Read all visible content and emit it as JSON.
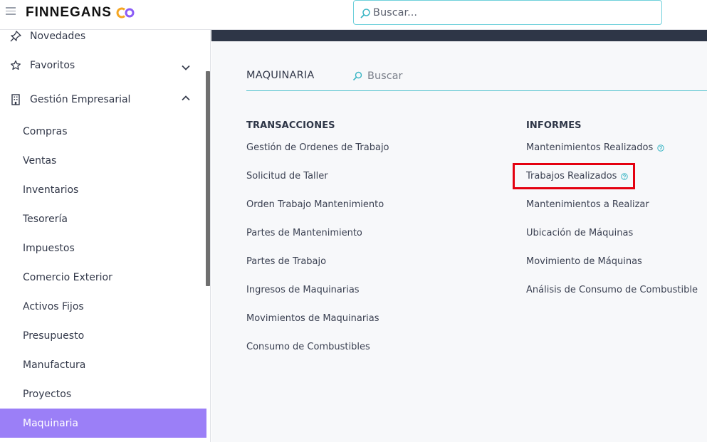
{
  "header": {
    "brand": "FINNEGANS",
    "search_placeholder": "Buscar..."
  },
  "sidebar": {
    "items": [
      {
        "label": "Novedades",
        "icon": "pin-icon"
      },
      {
        "label": "Favoritos",
        "icon": "star-icon",
        "chevron": "chevron-down-icon"
      },
      {
        "label": "Gestión Empresarial",
        "icon": "building-icon",
        "chevron": "chevron-up-icon"
      }
    ],
    "sub_items": [
      "Compras",
      "Ventas",
      "Inventarios",
      "Tesorería",
      "Impuestos",
      "Comercio Exterior",
      "Activos Fijos",
      "Presupuesto",
      "Manufactura",
      "Proyectos",
      "Maquinaria"
    ],
    "active_sub_item": "Maquinaria"
  },
  "main": {
    "module_title": "MAQUINARIA",
    "search_placeholder": "Buscar",
    "transacciones": {
      "heading": "TRANSACCIONES",
      "links": [
        "Gestión de Ordenes de Trabajo",
        "Solicitud de Taller",
        "Orden Trabajo Mantenimiento",
        "Partes de Mantenimiento",
        "Partes de Trabajo",
        "Ingresos de Maquinarias",
        "Movimientos de Maquinarias",
        "Consumo de Combustibles"
      ]
    },
    "informes": {
      "heading": "INFORMES",
      "links": [
        "Mantenimientos Realizados",
        "Trabajos Realizados",
        "Mantenimientos a Realizar",
        "Ubicación de Máquinas",
        "Movimiento de Máquinas",
        "Análisis de Consumo de Combustible"
      ],
      "help_icon_on": [
        "Mantenimientos Realizados",
        "Trabajos Realizados"
      ],
      "highlighted": "Trabajos Realizados"
    }
  },
  "colors": {
    "accent": "#55c3cf",
    "active_item": "#9b7ff7",
    "header_band": "#2e3647",
    "highlight": "#e4000f",
    "logo_orange": "#f5a623",
    "logo_purple": "#8b5cf6"
  }
}
